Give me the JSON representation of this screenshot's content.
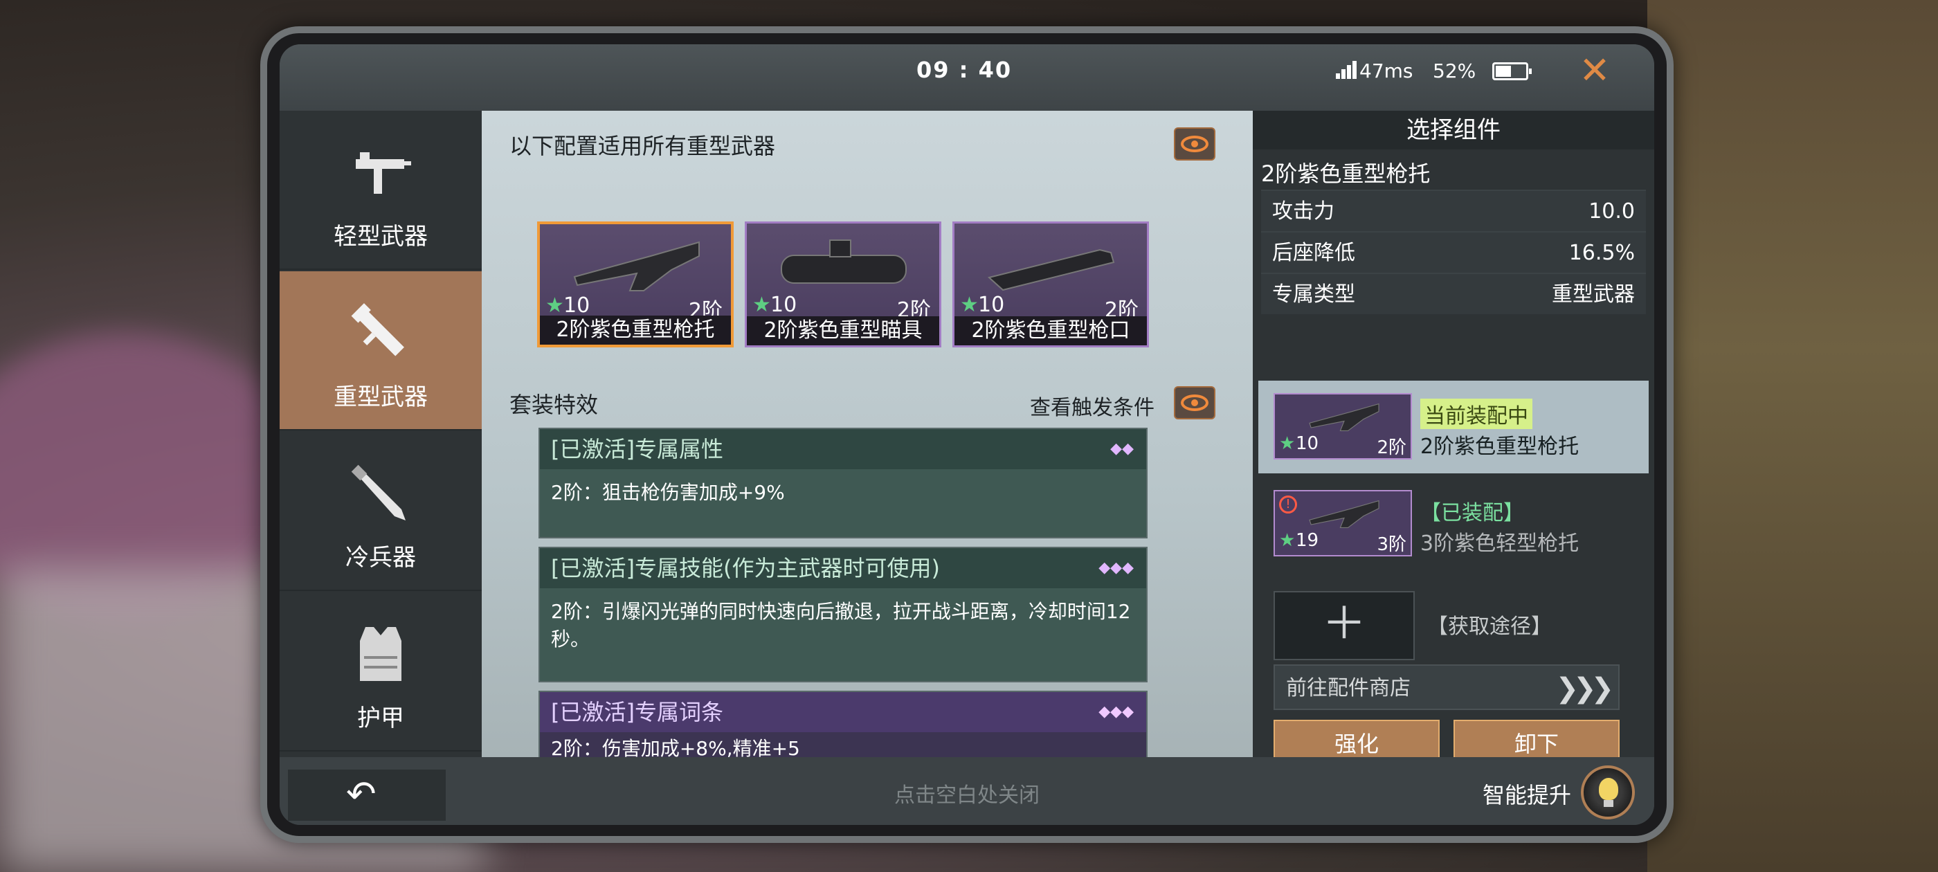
{
  "status": {
    "time": "09 : 40",
    "ping": "47ms",
    "battery": "52%",
    "battery_level": 0.52
  },
  "sidebar": {
    "items": [
      {
        "label": "轻型武器",
        "icon": "uzi-icon"
      },
      {
        "label": "重型武器",
        "icon": "rocket-launcher-icon",
        "active": true
      },
      {
        "label": "冷兵器",
        "icon": "machete-icon"
      },
      {
        "label": "护甲",
        "icon": "vest-icon"
      }
    ]
  },
  "center": {
    "title": "以下配置适用所有重型武器",
    "parts": [
      {
        "level": "10",
        "tier": "2阶",
        "name": "2阶紫色重型枪托",
        "selected": true
      },
      {
        "level": "10",
        "tier": "2阶",
        "name": "2阶紫色重型瞄具"
      },
      {
        "level": "10",
        "tier": "2阶",
        "name": "2阶紫色重型枪口"
      }
    ],
    "set_title": "套装特效",
    "trigger_label": "查看触发条件",
    "effects": [
      {
        "head": "[已激活]专属属性",
        "dots": "◆◆",
        "body": "2阶：狙击枪伤害加成+9%"
      },
      {
        "head": "[已激活]专属技能(作为主武器时可使用)",
        "dots": "◆◆◆",
        "body": "2阶：引爆闪光弹的同时快速向后撤退，拉开战斗距离，冷却时间12秒。"
      },
      {
        "head": "[已激活]专属词条",
        "dots": "◆◆◆",
        "body": "2阶：伤害加成+8%,精准+5"
      }
    ]
  },
  "right": {
    "title": "选择组件",
    "part_name": "2阶紫色重型枪托",
    "stats": [
      {
        "label": "攻击力",
        "value": "10.0"
      },
      {
        "label": "后座降低",
        "value": "16.5%"
      },
      {
        "label": "专属类型",
        "value": "重型武器"
      }
    ],
    "current": {
      "badge": "当前装配中",
      "name": "2阶紫色重型枪托",
      "level": "10",
      "tier": "2阶"
    },
    "worn": {
      "badge": "【已装配】",
      "name": "3阶紫色轻型枪托",
      "level": "19",
      "tier": "3阶"
    },
    "get_way": "【获取途径】",
    "shop": "前往配件商店",
    "upgrade": "强化",
    "unequip": "卸下"
  },
  "bottom": {
    "hint": "点击空白处关闭",
    "smart": "智能提升"
  },
  "colors": {
    "accent": "#f09a38",
    "active_tab": "#a27658",
    "purple_border": "#a27dc4"
  }
}
